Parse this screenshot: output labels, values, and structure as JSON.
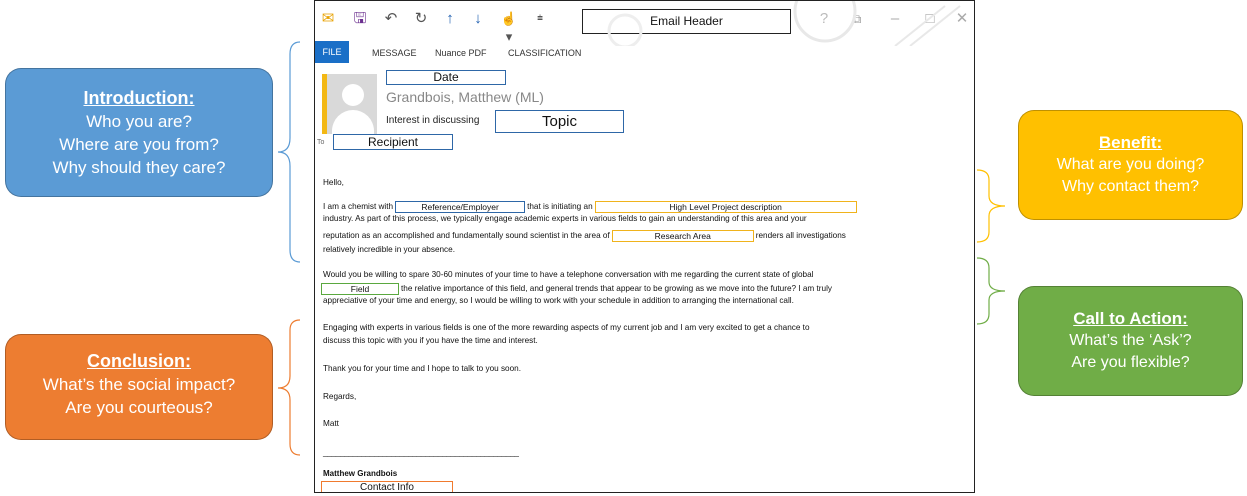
{
  "toolbar": {
    "email_header": "Email Header",
    "icons": [
      "mail-icon",
      "save-icon",
      "undo-icon",
      "redo-icon",
      "up-arrow-icon",
      "down-arrow-icon",
      "touch-icon",
      "dropdown-icon",
      "help-icon",
      "restore-icon",
      "minimize-icon",
      "maximize-icon",
      "close-icon"
    ]
  },
  "ribbon": {
    "tabs": [
      "FILE",
      "MESSAGE",
      "Nuance PDF",
      "CLASSIFICATION"
    ]
  },
  "header": {
    "date_box": "Date",
    "sender": "Grandbois, Matthew (ML)",
    "subject_prefix": "Interest in discussing",
    "topic_box": "Topic",
    "to_label": "To",
    "recipient_box": "Recipient"
  },
  "body": {
    "greeting": "Hello,",
    "p1_a": "I am a chemist with",
    "box_employer": "Reference/Employer",
    "p1_b": "that is initiating an",
    "box_project": "High Level Project description",
    "p1_line2": "industry. As part of this process, we typically engage academic experts in various fields to gain an understanding of this area and your",
    "p1_line3a": "reputation as an accomplished and fundamentally sound scientist in the area of",
    "box_research": "Research Area",
    "p1_line3b": "renders all investigations",
    "p1_line4": "relatively incredible in your absence.",
    "p2_line1": "Would you be willing to spare 30-60 minutes of your time to have a telephone conversation with me regarding the current state of global",
    "box_field": "Field",
    "p2_line2": "the relative importance of this field, and general trends that appear to be growing as we move into the future? I am truly",
    "p2_line3": "appreciative of your time and energy, so I would be willing to work with your schedule in addition to arranging the international call.",
    "p3_line1": "Engaging with experts in various fields is one of the more rewarding aspects of my current job and I am very excited to get a chance to",
    "p3_line2": "discuss this topic with you if you have the time and interest.",
    "p4": "Thank you for your time and I hope to talk to you soon.",
    "regards": "Regards,",
    "signoff": "Matt",
    "signature_line": "______________________________________________",
    "sig_name": "Matthew Grandbois",
    "box_contact": "Contact Info"
  },
  "callouts": {
    "intro": {
      "title": "Introduction:",
      "lines": [
        "Who you are?",
        "Where are you from?",
        "Why should they care?"
      ],
      "color": "#5b9bd5"
    },
    "benefit": {
      "title": "Benefit:",
      "lines": [
        "What are you doing?",
        "Why contact them?"
      ],
      "color": "#ffc000"
    },
    "action": {
      "title": "Call to Action:",
      "lines": [
        "What’s the ‘Ask’?",
        "Are you flexible?"
      ],
      "color": "#70ad47"
    },
    "conclusion": {
      "title": "Conclusion:",
      "lines": [
        "What’s the social impact?",
        "Are you courteous?"
      ],
      "color": "#ed7d31"
    }
  }
}
